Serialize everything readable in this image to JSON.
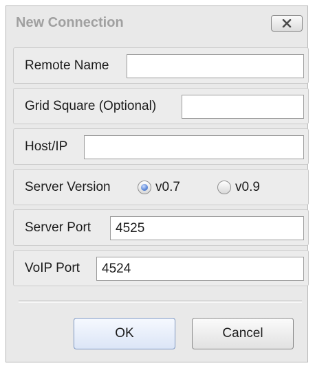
{
  "dialog": {
    "title": "New Connection",
    "close_icon": "close-x-icon"
  },
  "form": {
    "remote_name": {
      "label": "Remote Name",
      "value": ""
    },
    "grid_square": {
      "label": "Grid Square (Optional)",
      "value": ""
    },
    "host_ip": {
      "label": "Host/IP",
      "value": ""
    },
    "server_version": {
      "label": "Server Version",
      "options": [
        {
          "label": "v0.7",
          "selected": true
        },
        {
          "label": "v0.9",
          "selected": false
        }
      ]
    },
    "server_port": {
      "label": "Server Port",
      "value": "4525"
    },
    "voip_port": {
      "label": "VoIP Port",
      "value": "4524"
    }
  },
  "buttons": {
    "ok": "OK",
    "cancel": "Cancel"
  },
  "colors": {
    "radio_selected": "#5b86d6",
    "title_text": "#a0a0a0",
    "ok_border": "#7d97c2"
  }
}
